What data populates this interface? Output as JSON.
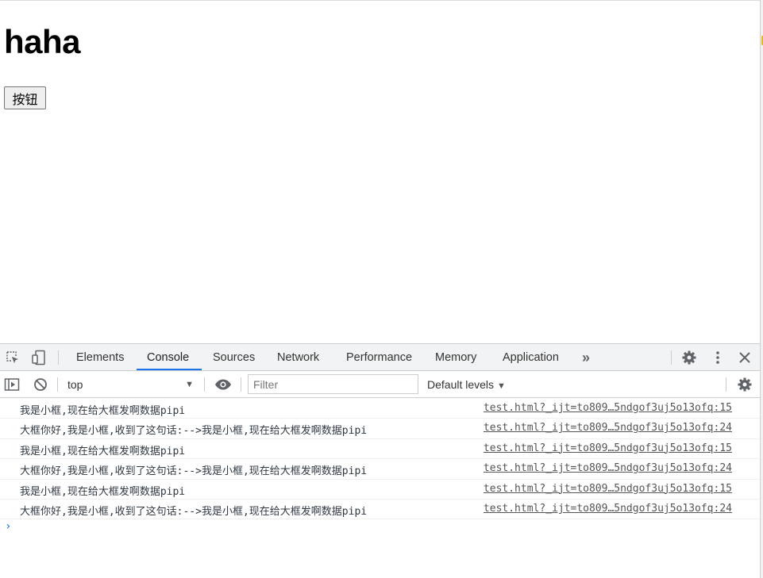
{
  "page": {
    "heading": "haha",
    "button_label": "按钮"
  },
  "devtools": {
    "tabs": [
      {
        "label": "Elements",
        "active": false
      },
      {
        "label": "Console",
        "active": true
      },
      {
        "label": "Sources",
        "active": false
      },
      {
        "label": "Network",
        "active": false
      },
      {
        "label": "Performance",
        "active": false
      },
      {
        "label": "Memory",
        "active": false
      },
      {
        "label": "Application",
        "active": false
      }
    ],
    "more_tabs_glyph": "»",
    "toolbar": {
      "context": "top",
      "filter_placeholder": "Filter",
      "levels_label": "Default levels"
    },
    "logs": [
      {
        "message": "我是小框,现在给大框发啊数据pipi",
        "source": "test.html?_ijt=to809…5ndgof3uj5o13ofq:15"
      },
      {
        "message": "大框你好,我是小框,收到了这句话:-->我是小框,现在给大框发啊数据pipi",
        "source": "test.html?_ijt=to809…5ndgof3uj5o13ofq:24"
      },
      {
        "message": "我是小框,现在给大框发啊数据pipi",
        "source": "test.html?_ijt=to809…5ndgof3uj5o13ofq:15"
      },
      {
        "message": "大框你好,我是小框,收到了这句话:-->我是小框,现在给大框发啊数据pipi",
        "source": "test.html?_ijt=to809…5ndgof3uj5o13ofq:24"
      },
      {
        "message": "我是小框,现在给大框发啊数据pipi",
        "source": "test.html?_ijt=to809…5ndgof3uj5o13ofq:15"
      },
      {
        "message": "大框你好,我是小框,收到了这句话:-->我是小框,现在给大框发啊数据pipi",
        "source": "test.html?_ijt=to809…5ndgof3uj5o13ofq:24"
      }
    ],
    "prompt_glyph": "›",
    "icons": [
      "inspect-icon",
      "device-toggle-icon",
      "settings-gear-icon",
      "kebab-menu-icon",
      "close-icon",
      "sidebar-toggle-icon",
      "clear-console-icon",
      "eye-icon"
    ],
    "accent_color": "#1a73e8"
  }
}
